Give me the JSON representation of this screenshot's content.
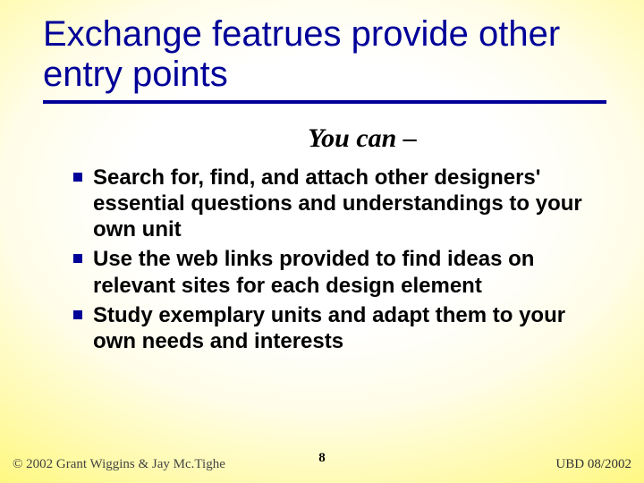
{
  "title": "Exchange featrues provide other entry points",
  "subtitle": "You can –",
  "bullets": [
    "Search for, find, and attach other designers' essential questions and understandings to your own unit",
    "Use the web links provided to find ideas on relevant sites for each design element",
    "Study exemplary units and adapt them to your own needs and interests"
  ],
  "footer": {
    "left": "© 2002 Grant Wiggins & Jay Mc.Tighe",
    "center": "8",
    "right": "UBD 08/2002"
  }
}
